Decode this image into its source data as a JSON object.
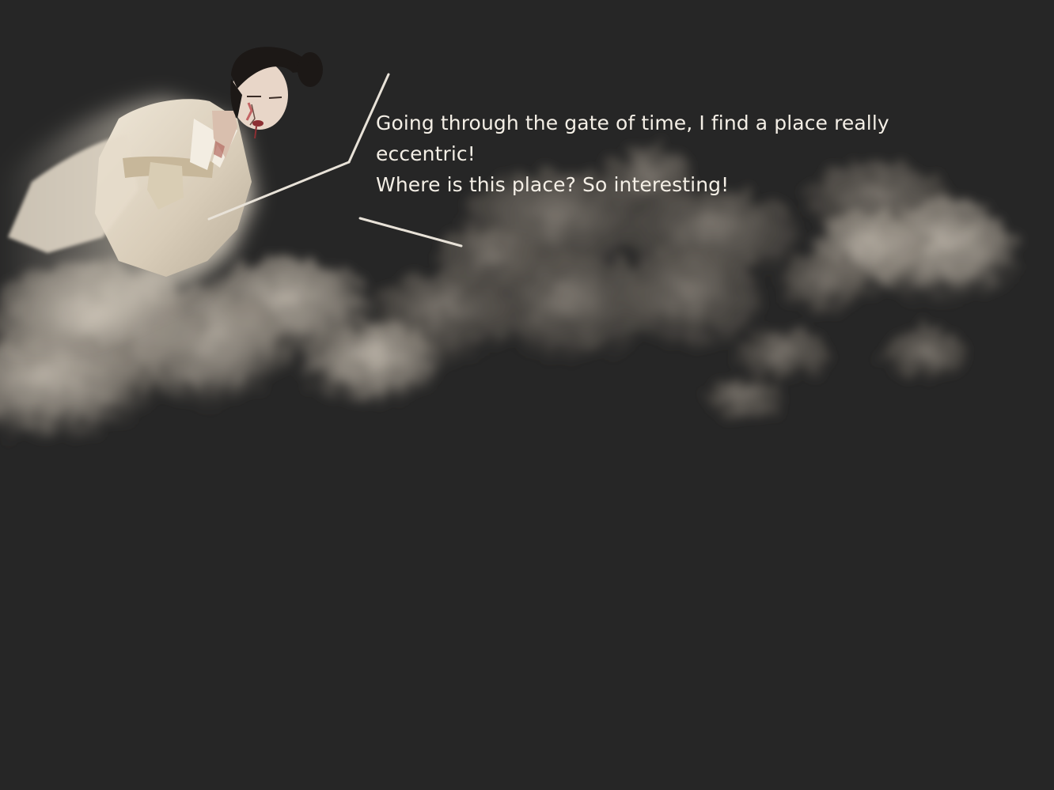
{
  "scene": {
    "background_color": "#262626",
    "character_icon": "robed-woman-figure",
    "cloud_icon": "cloud-bank"
  },
  "dialogue": {
    "lines": [
      "Going through the gate of time, I find a place really",
      "eccentric!",
      "Where is this place? So interesting!"
    ],
    "text_color": "#f4efe6"
  }
}
